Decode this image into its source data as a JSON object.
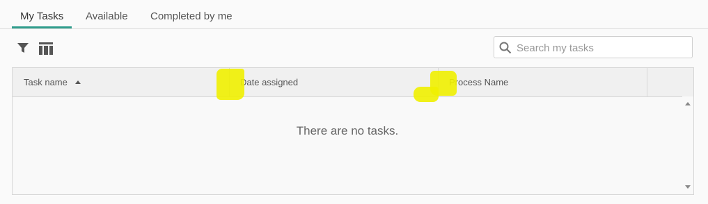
{
  "tabs": [
    {
      "label": "My Tasks",
      "active": true
    },
    {
      "label": "Available",
      "active": false
    },
    {
      "label": "Completed by me",
      "active": false
    }
  ],
  "toolbar": {
    "filter_icon": "filter-icon",
    "columns_icon": "columns-icon"
  },
  "search": {
    "placeholder": "Search my tasks",
    "value": ""
  },
  "grid": {
    "columns": [
      {
        "label": "Task name",
        "sort": "ascending"
      },
      {
        "label": "Date assigned"
      },
      {
        "label": "Process Name"
      }
    ],
    "empty_message": "There are no tasks."
  },
  "colors": {
    "accent": "#2e9c8c",
    "highlight": "#f0f000"
  }
}
